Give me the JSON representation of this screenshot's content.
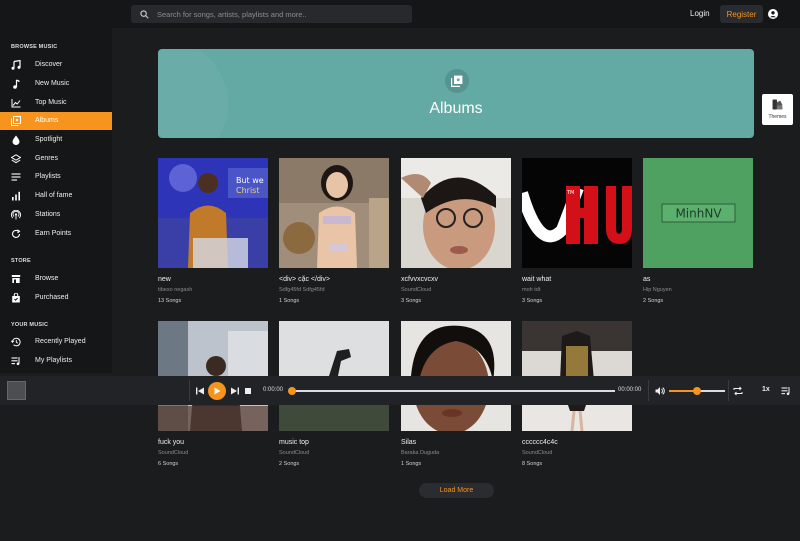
{
  "search": {
    "placeholder": "Search for songs, artists, playlists and more.."
  },
  "header": {
    "login_label": "Login",
    "register_label": "Register"
  },
  "sidebar": {
    "sections": [
      {
        "title": "BROWSE MUSIC"
      },
      {
        "title": "STORE"
      },
      {
        "title": "YOUR MUSIC"
      }
    ],
    "items": [
      {
        "label": "Discover",
        "icon": "music-note-icon"
      },
      {
        "label": "New Music",
        "icon": "single-note-icon"
      },
      {
        "label": "Top Music",
        "icon": "line-chart-icon"
      },
      {
        "label": "Albums",
        "icon": "album-icon",
        "active": true
      },
      {
        "label": "Spotlight",
        "icon": "drop-icon"
      },
      {
        "label": "Genres",
        "icon": "layers-icon"
      },
      {
        "label": "Playlists",
        "icon": "playlist-icon"
      },
      {
        "label": "Hall of fame",
        "icon": "bar-chart-icon"
      },
      {
        "label": "Stations",
        "icon": "radio-tower-icon"
      },
      {
        "label": "Earn Points",
        "icon": "refresh-icon"
      },
      {
        "label": "Browse",
        "icon": "store-icon"
      },
      {
        "label": "Purchased",
        "icon": "bag-icon"
      },
      {
        "label": "Recently Played",
        "icon": "history-icon"
      },
      {
        "label": "My Playlists",
        "icon": "queue-music-icon"
      }
    ]
  },
  "hero": {
    "title": "Albums"
  },
  "themes": {
    "label": "Themes"
  },
  "albums": [
    {
      "title": "new",
      "artist": "tibeso negash",
      "count": "13 Songs"
    },
    {
      "title": "<div> cặc </div>",
      "artist": "Sdfg45fd Sdfg45fd",
      "count": "1 Songs"
    },
    {
      "title": "xcfvvxcvcxv",
      "artist": "SoundCloud",
      "count": "3 Songs"
    },
    {
      "title": "wait what",
      "artist": "moh tdt",
      "count": "3 Songs"
    },
    {
      "title": "as",
      "artist": "Hip Nguyen",
      "count": "2 Songs",
      "cover_text": "MinhNV"
    },
    {
      "title": "fuck you",
      "artist": "SoundCloud",
      "count": "6 Songs"
    },
    {
      "title": "music top",
      "artist": "SoundCloud",
      "count": "2 Songs"
    },
    {
      "title": "Silas",
      "artist": "Baraka Duguda",
      "count": "1 Songs"
    },
    {
      "title": "cccccc4c4c",
      "artist": "SoundCloud",
      "count": "8 Songs"
    }
  ],
  "load_more_label": "Load More",
  "player": {
    "current_time": "0:00:00",
    "duration": "00:00:00",
    "progress": 0,
    "volume": 0.5,
    "speed": "1x"
  },
  "colors": {
    "accent": "#f7941d",
    "hero": "#63a9a4",
    "background": "#1b1c1e"
  }
}
